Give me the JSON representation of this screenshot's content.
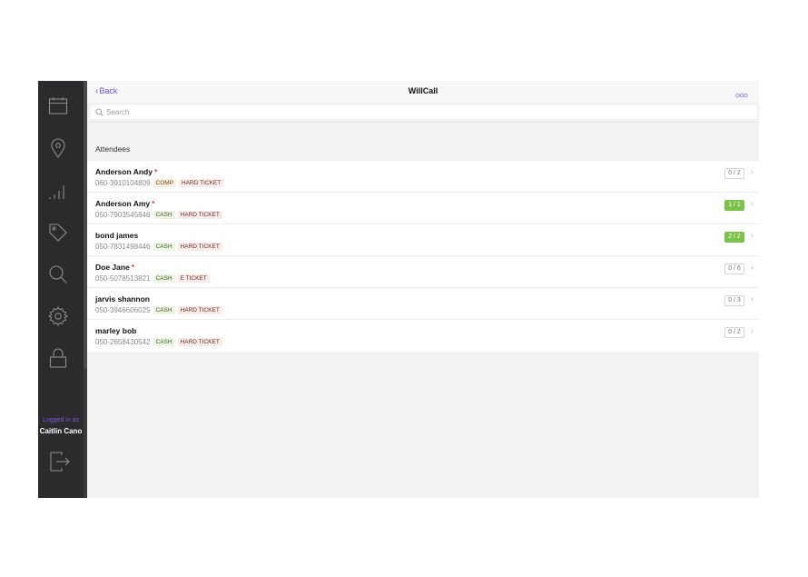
{
  "sidebar": {
    "icons": [
      "calendar-icon",
      "location-pin-icon",
      "signal-bars-icon",
      "tag-icon",
      "search-icon",
      "gear-icon",
      "lock-icon",
      "logout-icon"
    ],
    "logged_in_label": "Logged in as",
    "user_name": "Caitlin Cano"
  },
  "nav": {
    "back_label": "Back",
    "title": "WillCall",
    "more_icon": "more-icon"
  },
  "search": {
    "placeholder": "Search",
    "value": ""
  },
  "section": {
    "header": "Attendees"
  },
  "colors": {
    "accent": "#6b4fd8",
    "complete": "#7cc24a",
    "required_star": "#e0463a",
    "sidebar": "#2b2b2d"
  },
  "attendees": [
    {
      "name": "Anderson Andy",
      "required": "*",
      "phone": "060-3910104809",
      "payment": "COMP",
      "ticket": "HARD TICKET",
      "count": "0 / 2",
      "complete": false
    },
    {
      "name": "Anderson Amy",
      "required": "*",
      "phone": "050-7903545846",
      "payment": "CASH",
      "ticket": "HARD TICKET",
      "count": "1 / 1",
      "complete": true
    },
    {
      "name": "bond james",
      "required": "",
      "phone": "050-7831498446",
      "payment": "CASH",
      "ticket": "HARD TICKET",
      "count": "2 / 2",
      "complete": true
    },
    {
      "name": "Doe Jane",
      "required": "*",
      "phone": "050-5078513821",
      "payment": "CASH",
      "ticket": "E TICKET",
      "count": "0 / 6",
      "complete": false
    },
    {
      "name": "jarvis shannon",
      "required": "",
      "phone": "050-3946606025",
      "payment": "CASH",
      "ticket": "HARD TICKET",
      "count": "0 / 3",
      "complete": false
    },
    {
      "name": "marley bob",
      "required": "",
      "phone": "050-2658430542",
      "payment": "CASH",
      "ticket": "HARD TICKET",
      "count": "0 / 2",
      "complete": false
    }
  ]
}
